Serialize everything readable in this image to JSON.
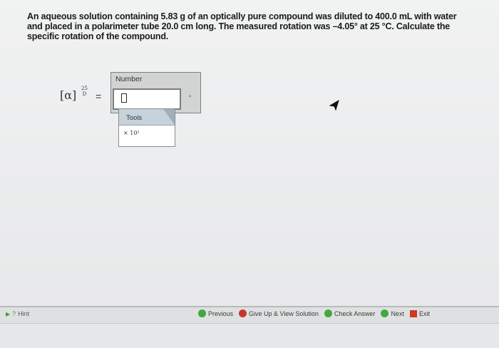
{
  "question": {
    "text": "An aqueous solution containing 5.83 g of an optically pure compound was diluted to 400.0 mL with water and placed in a polarimeter tube 20.0 cm long. The measured rotation was –4.05° at 25 °C. Calculate the specific rotation of the compound."
  },
  "answer": {
    "symbol": "[α]",
    "sup": "25",
    "sub": "D",
    "equals": "=",
    "number_label": "Number",
    "number_value": "",
    "unit": "°"
  },
  "tools": {
    "label": "Tools",
    "item": "× 10¹"
  },
  "footer": {
    "hint": "Hint",
    "previous": "Previous",
    "give_up": "Give Up & View Solution",
    "check": "Check Answer",
    "next": "Next",
    "exit": "Exit"
  },
  "colors": {
    "accent_green": "#43a83e",
    "give_up_red": "#c9352b",
    "exit_red": "#cc3b24"
  }
}
